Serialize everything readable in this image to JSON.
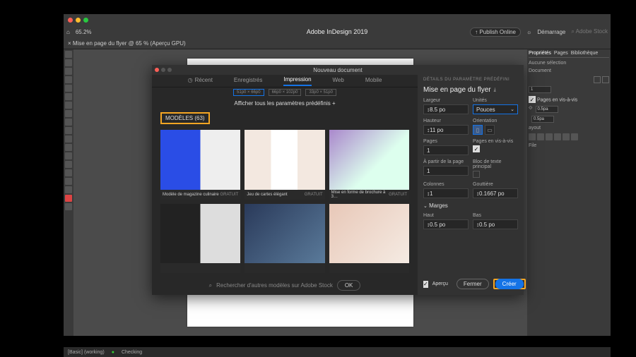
{
  "app": {
    "title": "Adobe InDesign 2019",
    "traffic_colors": [
      "#ff5f57",
      "#febc2e",
      "#28c840"
    ],
    "zoom": "65.2%",
    "publish": "Publish Online",
    "workspace_menu": "Démarrage",
    "search_placeholder": "Adobe Stock",
    "document_tab": "× Mise en page du flyer @ 65 % (Aperçu GPU)"
  },
  "panels": {
    "tabs": [
      "Propriétés",
      "Pages",
      "Bibliothèque"
    ],
    "no_selection": "Aucune sélection",
    "doc_label": "Document",
    "facing": "Pages en vis-à-vis",
    "w": "0.5pa",
    "h": "0.5pa",
    "layout": "ayout",
    "file": "File"
  },
  "dialog": {
    "title": "Nouveau document",
    "tabs": [
      "Récent",
      "Enregistrés",
      "Impression",
      "Web",
      "Mobile"
    ],
    "active_tab": 2,
    "presets": [
      {
        "dims": "51p0 × 66p0",
        "selected": true
      },
      {
        "dims": "66p0 × 102p0",
        "selected": false
      },
      {
        "dims": "33p0 × 51p0",
        "selected": false
      }
    ],
    "view_all": "Afficher tous les paramètres prédéfinis +",
    "models_label": "MODÈLES (63)",
    "templates": [
      {
        "name": "Modèle de magazine culinaire",
        "price": "GRATUIT"
      },
      {
        "name": "Jeu de cartes élégant",
        "price": "GRATUIT"
      },
      {
        "name": "Mise en forme de brochure à 3…",
        "price": "GRATUIT"
      },
      {
        "name": "",
        "price": ""
      },
      {
        "name": "",
        "price": ""
      },
      {
        "name": "",
        "price": ""
      }
    ],
    "search_placeholder": "Rechercher d'autres modèles sur Adobe Stock",
    "ok": "OK",
    "details": {
      "section": "DÉTAILS DU PARAMÈTRE PRÉDÉFINI",
      "name": "Mise en page du flyer",
      "largeur_label": "Largeur",
      "largeur": "8.5 po",
      "unites_label": "Unités",
      "unites": "Pouces",
      "hauteur_label": "Hauteur",
      "hauteur": "11 po",
      "orientation_label": "Orientation",
      "pages_label": "Pages",
      "pages": "1",
      "facing_label": "Pages en vis-à-vis",
      "start_label": "À partir de la page",
      "start": "1",
      "frame_label": "Bloc de texte principal",
      "colonnes_label": "Colonnes",
      "colonnes": "1",
      "gout_label": "Gouttière",
      "gout": "0.1667 po",
      "marges_label": "Marges",
      "haut_label": "Haut",
      "haut": "0.5 po",
      "bas_label": "Bas",
      "bas": "0.5 po",
      "apercu": "Aperçu",
      "fermer": "Fermer",
      "creer": "Créer"
    }
  },
  "status": {
    "basic": "[Basic] (working)",
    "checking": "Checking"
  }
}
